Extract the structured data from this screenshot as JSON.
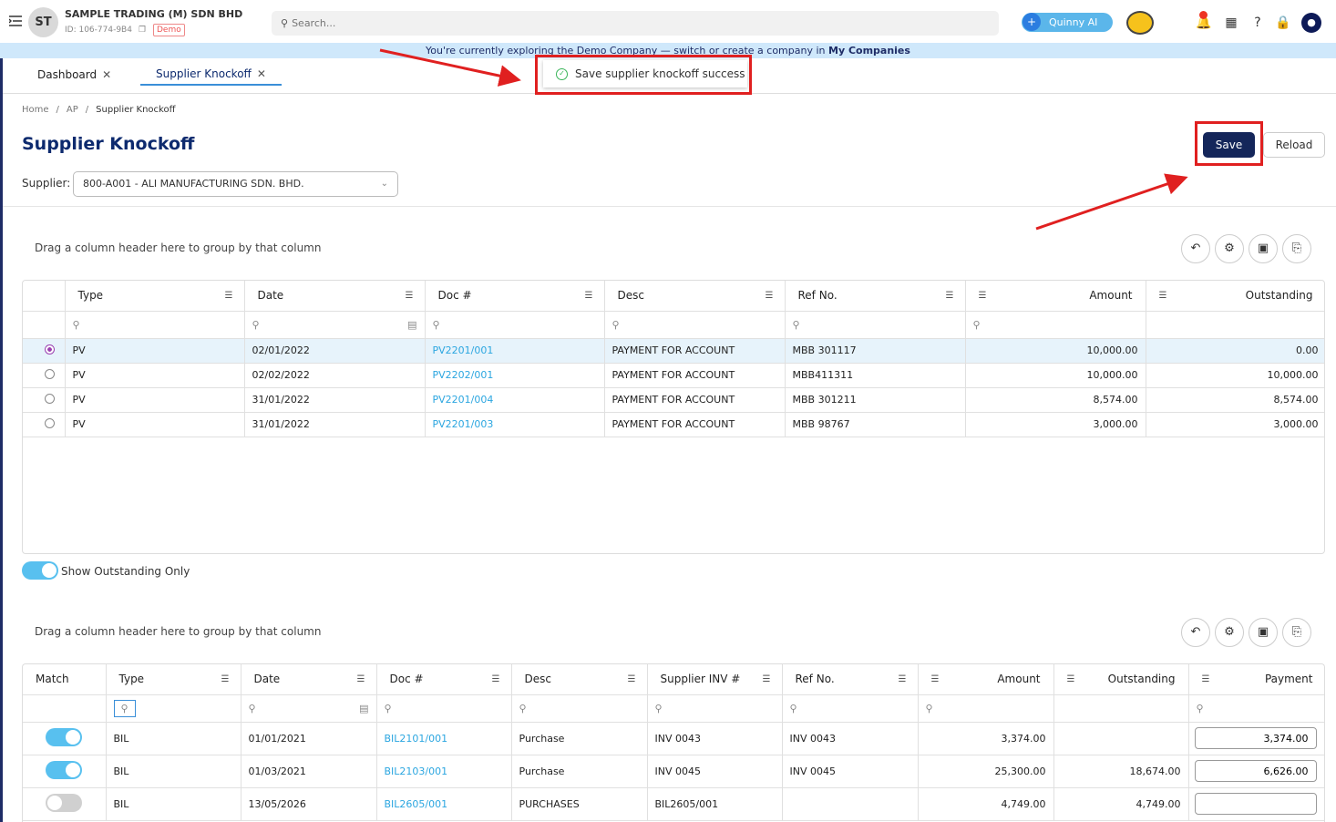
{
  "header": {
    "avatar_initials": "ST",
    "company_name": "SAMPLE TRADING (M) SDN BHD",
    "company_id": "ID: 106-774-9B4",
    "demo_badge": "Demo",
    "search_placeholder": "Search...",
    "assistant_label": "Quinny AI"
  },
  "banner": {
    "text": "You're currently exploring the Demo Company — switch or create a company in ",
    "link": "My Companies"
  },
  "tabs": [
    {
      "label": "Dashboard"
    },
    {
      "label": "Supplier Knockoff"
    }
  ],
  "toast": {
    "message": "Save supplier knockoff success"
  },
  "breadcrumb": {
    "home": "Home",
    "section": "AP",
    "current": "Supplier Knockoff"
  },
  "page": {
    "title": "Supplier Knockoff",
    "save_label": "Save",
    "reload_label": "Reload",
    "supplier_label": "Supplier:",
    "supplier_value": "800-A001 - ALI MANUFACTURING SDN. BHD."
  },
  "payments_grid": {
    "group_hint": "Drag a column header here to group by that column",
    "columns": [
      "Type",
      "Date",
      "Doc #",
      "Desc",
      "Ref No.",
      "Amount",
      "Outstanding"
    ],
    "rows": [
      {
        "selected": true,
        "type": "PV",
        "date": "02/01/2022",
        "doc": "PV2201/001",
        "desc": "PAYMENT FOR ACCOUNT",
        "ref": "MBB 301117",
        "amount": "10,000.00",
        "outstanding": "0.00"
      },
      {
        "selected": false,
        "type": "PV",
        "date": "02/02/2022",
        "doc": "PV2202/001",
        "desc": "PAYMENT FOR ACCOUNT",
        "ref": "MBB411311",
        "amount": "10,000.00",
        "outstanding": "10,000.00"
      },
      {
        "selected": false,
        "type": "PV",
        "date": "31/01/2022",
        "doc": "PV2201/004",
        "desc": "PAYMENT FOR ACCOUNT",
        "ref": "MBB 301211",
        "amount": "8,574.00",
        "outstanding": "8,574.00"
      },
      {
        "selected": false,
        "type": "PV",
        "date": "31/01/2022",
        "doc": "PV2201/003",
        "desc": "PAYMENT FOR ACCOUNT",
        "ref": "MBB 98767",
        "amount": "3,000.00",
        "outstanding": "3,000.00"
      }
    ]
  },
  "show_outstanding_label": "Show Outstanding Only",
  "invoices_grid": {
    "group_hint": "Drag a column header here to group by that column",
    "columns": [
      "Match",
      "Type",
      "Date",
      "Doc #",
      "Desc",
      "Supplier INV #",
      "Ref No.",
      "Amount",
      "Outstanding",
      "Payment"
    ],
    "rows": [
      {
        "match": true,
        "type": "BIL",
        "date": "01/01/2021",
        "doc": "BIL2101/001",
        "desc": "Purchase",
        "inv": "INV 0043",
        "ref": "INV 0043",
        "amount": "3,374.00",
        "outstanding": "",
        "payment": "3,374.00"
      },
      {
        "match": true,
        "type": "BIL",
        "date": "01/03/2021",
        "doc": "BIL2103/001",
        "desc": "Purchase",
        "inv": "INV 0045",
        "ref": "INV 0045",
        "amount": "25,300.00",
        "outstanding": "18,674.00",
        "payment": "6,626.00"
      },
      {
        "match": false,
        "type": "BIL",
        "date": "13/05/2026",
        "doc": "BIL2605/001",
        "desc": "PURCHASES",
        "inv": "BIL2605/001",
        "ref": "",
        "amount": "4,749.00",
        "outstanding": "4,749.00",
        "payment": ""
      }
    ]
  },
  "colors": {
    "brand": "#0d2a6e",
    "accent": "#58c0ef",
    "link": "#2ba6e0",
    "annotation": "#e02020"
  }
}
